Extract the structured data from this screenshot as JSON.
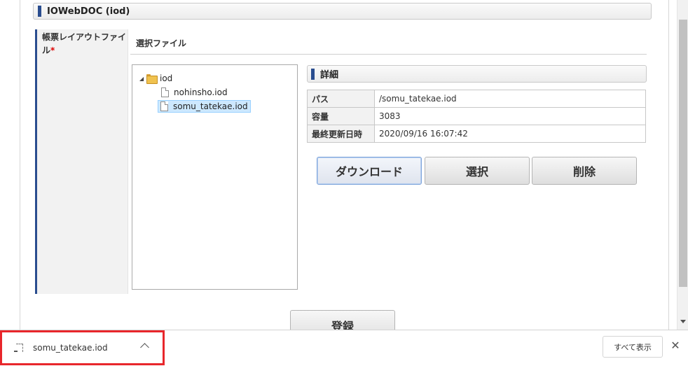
{
  "section": {
    "title": "IOWebDOC (iod)"
  },
  "field": {
    "label": "帳票レイアウトファイル",
    "required_mark": "*",
    "value_title": "選択ファイル"
  },
  "tree": {
    "root": {
      "label": "iod",
      "toggle": "◢",
      "icon": "folder-icon"
    },
    "children": [
      {
        "label": "nohinsho.iod",
        "icon": "file-icon",
        "selected": false
      },
      {
        "label": "somu_tatekae.iod",
        "icon": "file-icon",
        "selected": true
      }
    ]
  },
  "detail": {
    "title": "詳細",
    "rows": [
      {
        "key": "パス",
        "value": "/somu_tatekae.iod"
      },
      {
        "key": "容量",
        "value": "3083"
      },
      {
        "key": "最終更新日時",
        "value": "2020/09/16 16:07:42"
      }
    ]
  },
  "buttons": {
    "download": "ダウンロード",
    "select": "選択",
    "delete": "削除",
    "register": "登録"
  },
  "download_bar": {
    "file_name": "somu_tatekae.iod",
    "show_all": "すべて表示",
    "close": "✕"
  },
  "colors": {
    "accent_bar": "#2a4d8f",
    "highlight_border": "#e8262b",
    "selected_node_bg": "#cde8ff"
  }
}
